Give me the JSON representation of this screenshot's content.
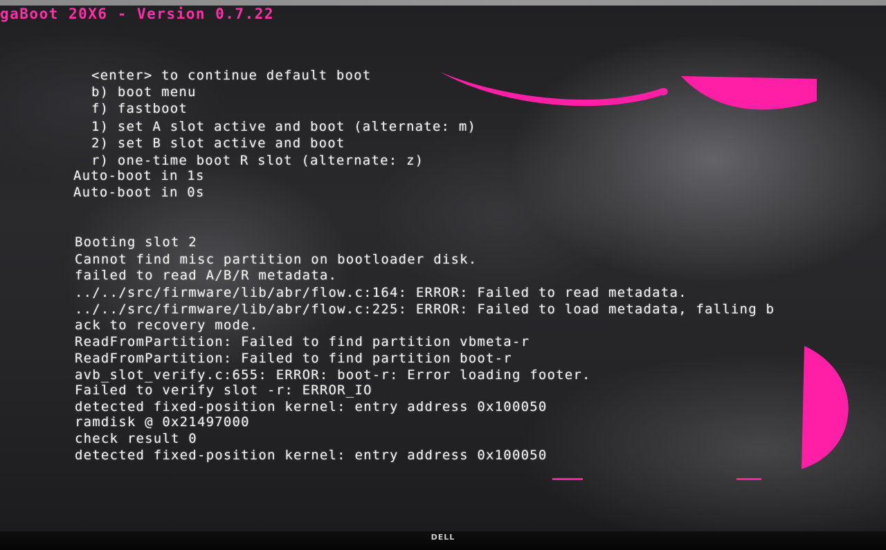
{
  "title_bar": {
    "text": "gaBoot 20X6 - Version 0.7.22",
    "color": "#ff2fa8"
  },
  "boot_menu": [
    "<enter> to continue default boot",
    "b) boot menu",
    "f) fastboot",
    "1) set A slot active and boot (alternate: m)",
    "2) set B slot active and boot",
    "r) one-time boot R slot (alternate: z)"
  ],
  "countdown": [
    "Auto-boot in 1s",
    "Auto-boot in 0s"
  ],
  "log": [
    "Booting slot 2",
    "Cannot find misc partition on bootloader disk.",
    "failed to read A/B/R metadata.",
    "../../src/firmware/lib/abr/flow.c:164: ERROR: Failed to read metadata.",
    "../../src/firmware/lib/abr/flow.c:225: ERROR: Failed to load metadata, falling b",
    "ack to recovery mode.",
    "ReadFromPartition: Failed to find partition vbmeta-r",
    "ReadFromPartition: Failed to find partition boot-r",
    "avb_slot_verify.c:655: ERROR: boot-r: Error loading footer.",
    "Failed to verify slot -r: ERROR_IO",
    "detected fixed-position kernel: entry address 0x100050",
    "ramdisk @ 0x21497000",
    "check result 0",
    "detected fixed-position kernel: entry address 0x100050"
  ],
  "monitor": {
    "brand": "DELL"
  },
  "colors": {
    "console_text": "#f2f2f2",
    "artifact": "#ff1fa6",
    "background": "#1a1a1a"
  }
}
